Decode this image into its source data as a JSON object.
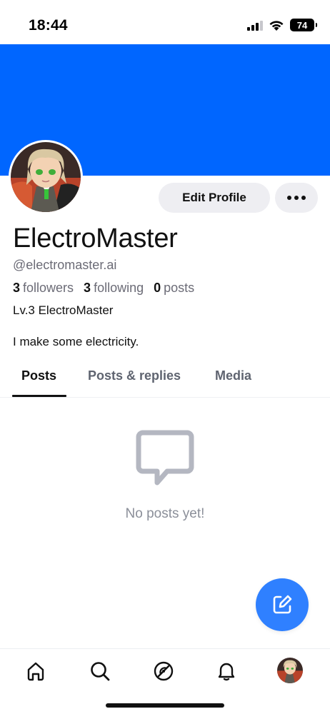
{
  "status_bar": {
    "time": "18:44",
    "battery": "74",
    "icons": [
      "signal-icon",
      "wifi-icon",
      "battery-icon"
    ]
  },
  "profile": {
    "banner_color": "#0066ff",
    "display_name": "ElectroMaster",
    "handle": "@electromaster.ai",
    "followers_count": "3",
    "followers_label": "followers",
    "following_count": "3",
    "following_label": "following",
    "posts_count": "0",
    "posts_label": "posts",
    "level": "Lv.3 ElectroMaster",
    "bio": "I make some electricity."
  },
  "actions": {
    "edit_label": "Edit Profile",
    "more_icon": "more-icon"
  },
  "tabs": [
    {
      "label": "Posts",
      "active": true
    },
    {
      "label": "Posts & replies",
      "active": false
    },
    {
      "label": "Media",
      "active": false
    }
  ],
  "empty_state": {
    "icon": "chat-bubble-icon",
    "text": "No posts yet!"
  },
  "fab": {
    "icon": "compose-icon",
    "color": "#2f80ff"
  },
  "bottom_nav": {
    "items": [
      "home-icon",
      "search-icon",
      "feeds-icon",
      "notifications-icon",
      "profile-avatar"
    ]
  }
}
